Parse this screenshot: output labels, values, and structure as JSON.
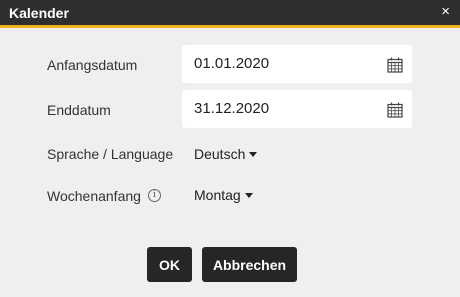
{
  "window": {
    "title": "Kalender",
    "close_glyph": "×"
  },
  "fields": {
    "start": {
      "label": "Anfangsdatum",
      "value": "01.01.2020",
      "icon": "calendar-icon"
    },
    "end": {
      "label": "Enddatum",
      "value": "31.12.2020",
      "icon": "calendar-icon"
    },
    "language": {
      "label": "Sprache / Language",
      "selected": "Deutsch"
    },
    "week_start": {
      "label": "Wochenanfang",
      "info_glyph": "i",
      "selected": "Montag"
    }
  },
  "buttons": {
    "ok": "OK",
    "cancel": "Abbrechen"
  },
  "colors": {
    "titlebar": "#2e2e2e",
    "accent": "#f2b21b",
    "button": "#262626",
    "background": "#efefef"
  }
}
